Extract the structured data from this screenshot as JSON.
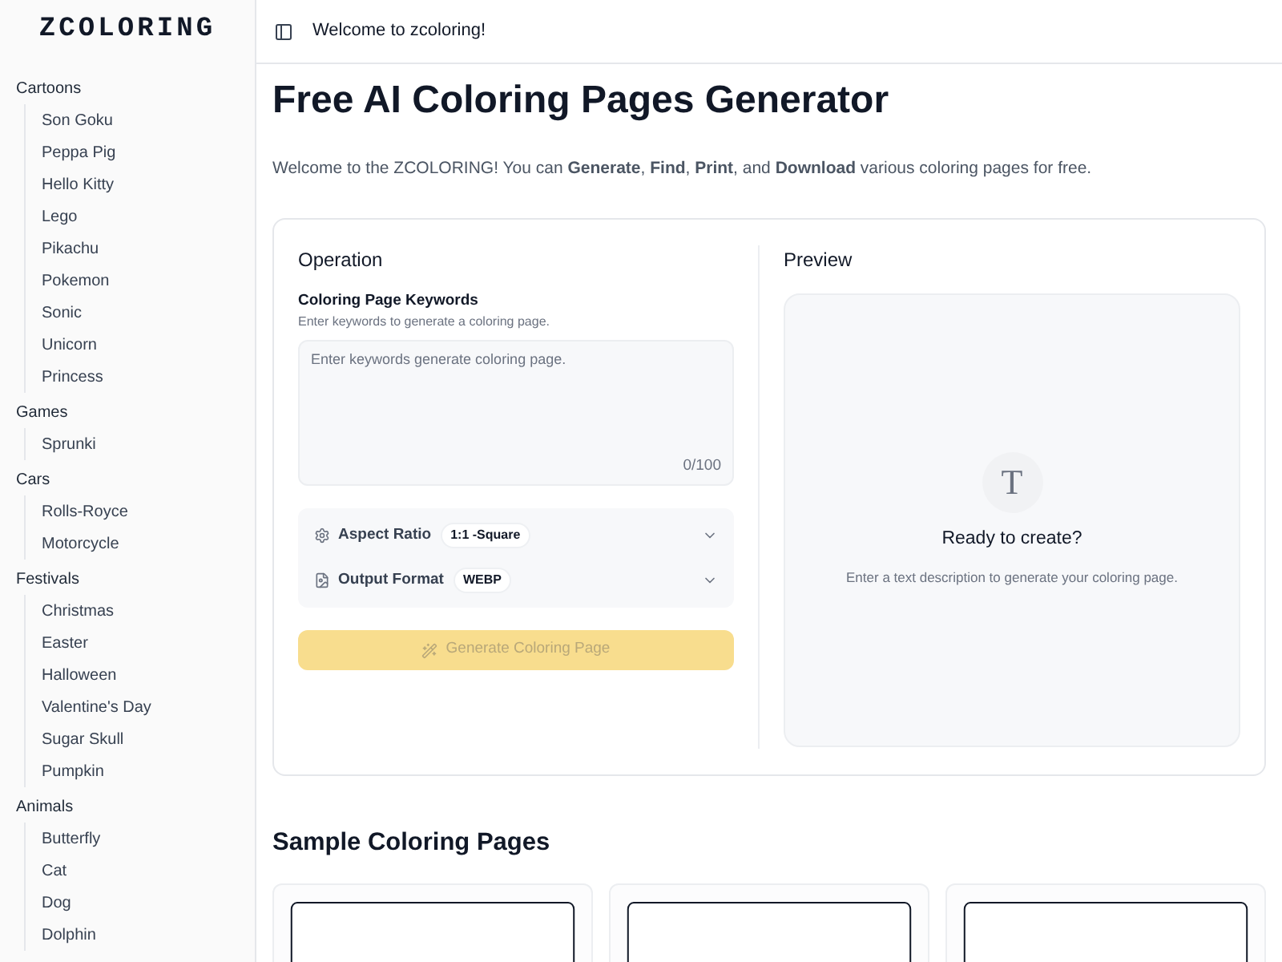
{
  "sidebar": {
    "logo": "ZCOLORING",
    "groups": [
      {
        "label": "Cartoons",
        "items": [
          "Son Goku",
          "Peppa Pig",
          "Hello Kitty",
          "Lego",
          "Pikachu",
          "Pokemon",
          "Sonic",
          "Unicorn",
          "Princess"
        ]
      },
      {
        "label": "Games",
        "items": [
          "Sprunki"
        ]
      },
      {
        "label": "Cars",
        "items": [
          "Rolls-Royce",
          "Motorcycle"
        ]
      },
      {
        "label": "Festivals",
        "items": [
          "Christmas",
          "Easter",
          "Halloween",
          "Valentine's Day",
          "Sugar Skull",
          "Pumpkin"
        ]
      },
      {
        "label": "Animals",
        "items": [
          "Butterfly",
          "Cat",
          "Dog",
          "Dolphin"
        ]
      }
    ]
  },
  "header": {
    "title": "Welcome to zcoloring!"
  },
  "page": {
    "title": "Free AI Coloring Pages Generator",
    "intro": "Welcome to the ZCOLORING! You can **Generate**, **Find**, **Print**, and **Download** various coloring pages for free."
  },
  "operation": {
    "title": "Operation",
    "keywords_label": "Coloring Page Keywords",
    "keywords_hint": "Enter keywords to generate a coloring page.",
    "placeholder": "Enter keywords generate coloring page.",
    "counter": "0/100",
    "options": [
      {
        "kind": "ratio",
        "label": "Aspect Ratio",
        "value": "1:1 -Square"
      },
      {
        "kind": "format",
        "label": "Output Format",
        "value": "WEBP"
      }
    ],
    "generate_button": {
      "label": "Generate Coloring Page",
      "disabled": true
    }
  },
  "preview": {
    "title": "Preview",
    "icon_letter": "T",
    "heading": "Ready to create?",
    "hint": "Enter a text description to generate your coloring page."
  },
  "samples": {
    "title": "Sample Coloring Pages"
  }
}
